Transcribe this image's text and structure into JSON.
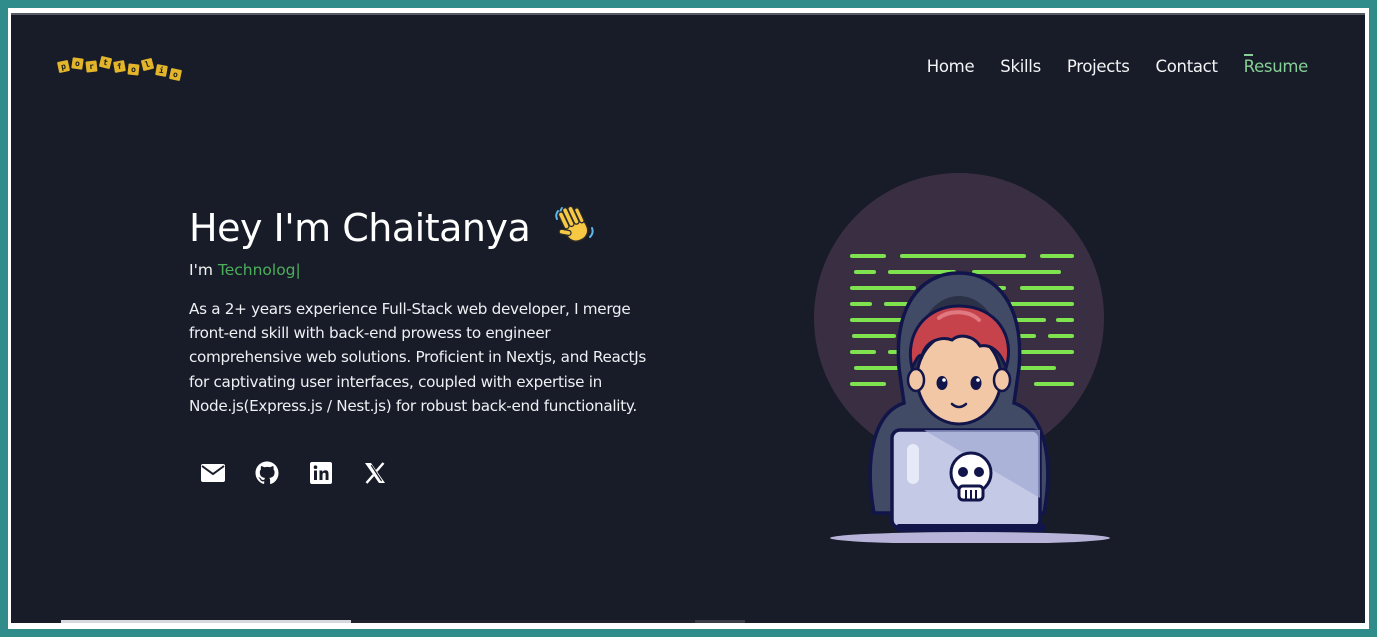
{
  "logo": {
    "letters": [
      "p",
      "o",
      "r",
      "t",
      "f",
      "o",
      "l",
      "i",
      "o"
    ]
  },
  "nav": {
    "items": [
      "Home",
      "Skills",
      "Projects",
      "Contact",
      "Resume"
    ]
  },
  "hero": {
    "title": "Hey I'm Chaitanya",
    "typed_prefix": "I'm ",
    "typed_word": "Technolog",
    "cursor": "|",
    "description": "As a 2+ years experience Full-Stack web developer, I merge front-end skill with back-end prowess to engineer comprehensive web solutions. Proficient in Nextjs, and ReactJs for captivating user interfaces, coupled with expertise in Node.js(Express.js / Nest.js) for robust back-end functionality."
  },
  "socials": [
    "mail-icon",
    "github-icon",
    "linkedin-icon",
    "x-icon"
  ],
  "colors": {
    "background": "#181c28",
    "accent_green": "#4cae5a",
    "resume_green": "#86cf96",
    "logo_yellow": "#e3b52a"
  }
}
